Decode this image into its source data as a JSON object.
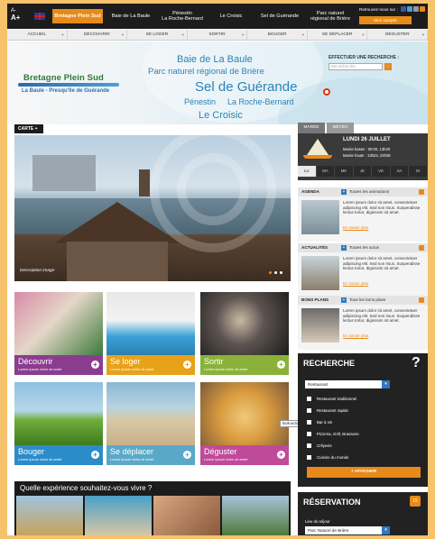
{
  "topbar": {
    "text_size_label": "A-",
    "text_size_label_2": "A+",
    "site_tabs": [
      {
        "label": "Bretagne Plein Sud",
        "active": true
      },
      {
        "label": "Baie de La Baule",
        "active": false
      },
      {
        "label": "Pénestin\nLa Roche-Bernard",
        "active": false
      },
      {
        "label": "Le Croisic",
        "active": false
      },
      {
        "label": "Sel de Guérande",
        "active": false
      },
      {
        "label": "Parc naturel\nrégional de Brière",
        "active": false
      }
    ],
    "follow_label": "Retrouvez-nous sur :",
    "account_label": "Mon compte"
  },
  "mainnav": [
    "ACCUEIL",
    "DÉCOUVRIR",
    "SE LOGER",
    "SORTIR",
    "BOUGER",
    "SE DÉPLACER",
    "DÉGUSTER"
  ],
  "header": {
    "logo_title": "Bretagne Plein Sud",
    "logo_subtitle": "La Baule - Presqu'île de Guérande",
    "places": [
      "Baie de La Baule",
      "Parc naturel régional de Brière",
      "Sel de Guérande",
      "Pénestin",
      "La Roche-Bernard",
      "Le Croisic"
    ],
    "search_label": "EFFECTUER UNE RECHERCHE :",
    "search_placeholder": "Mo recherche"
  },
  "carte_label": "CARTE +",
  "hero": {
    "caption": "Description image"
  },
  "meteo": {
    "tabs": [
      "MARÉE",
      "MÉTÉO"
    ],
    "date": "LUNDI 26 JUILLET",
    "line1": "Marée basse : 00:00, 13h20",
    "line2": "Marée haute : 13h24, 23h38",
    "days": [
      "LU",
      "MA",
      "ME",
      "JE",
      "VE",
      "SA",
      "DI"
    ]
  },
  "sidebar_blocks": [
    {
      "title": "AGENDA",
      "link": "Toutes les animations",
      "text": "Lorem ipsum dolor sit amet, consectetuer adipiscing elit. Sed non risus. Suspendisse lectus tortor, dignissim sit amet.",
      "more": "En savoir plus"
    },
    {
      "title": "ACTUALITÉS",
      "link": "Toutes les actus",
      "text": "Lorem ipsum dolor sit amet, consectetuer adipiscing elit. Sed non risus. Suspendisse lectus tortor, dignissim sit amet.",
      "more": "En savoir plus"
    },
    {
      "title": "BONS PLANS",
      "link": "Tous les bons plans",
      "text": "Lorem ipsum dolor sit amet, consectetuer adipiscing elit. Sed non risus. Suspendisse lectus tortor, dignissim sit amet.",
      "more": "En savoir plus"
    }
  ],
  "tiles": [
    {
      "title": "Découvrir",
      "desc": "Lorem ipsum dolor sit amet",
      "color": "#8a3d8f"
    },
    {
      "title": "Se loger",
      "desc": "Lorem ipsum dolor sit amet",
      "color": "#e8a21a"
    },
    {
      "title": "Sortir",
      "desc": "Lorem ipsum dolor sit amet",
      "color": "#8ab23a"
    },
    {
      "title": "Bouger",
      "desc": "Lorem ipsum dolor sit amet",
      "color": "#2c8cc9"
    },
    {
      "title": "Se déplacer",
      "desc": "Lorem ipsum dolor sit amet",
      "color": "#5aa8c8"
    },
    {
      "title": "Déguster",
      "desc": "Lorem ipsum dolor sit amet",
      "color": "#c04a9a"
    }
  ],
  "tooltip": "look-activity",
  "experience_title": "Quelle expérience souhaitez-vous vivre ?",
  "recherche": {
    "title": "RECHERCHE",
    "select_value": "Restaurant",
    "options": [
      "Restaurant traditionnel",
      "Restaurant rapide",
      "Bar à vin",
      "Pizzeria, Grill, Brasserie",
      "Crêperie",
      "Cuisine du monde"
    ],
    "button": "+ AFFICHER"
  },
  "reservation": {
    "title": "RÉSERVATION",
    "calendar_day": "15",
    "label": "Lieu du séjour",
    "select_value": "Parc Naturel de Brière"
  },
  "colors": {
    "accent": "#e88a1a",
    "dark": "#1c1c1c",
    "blue": "#2d7ac0"
  }
}
